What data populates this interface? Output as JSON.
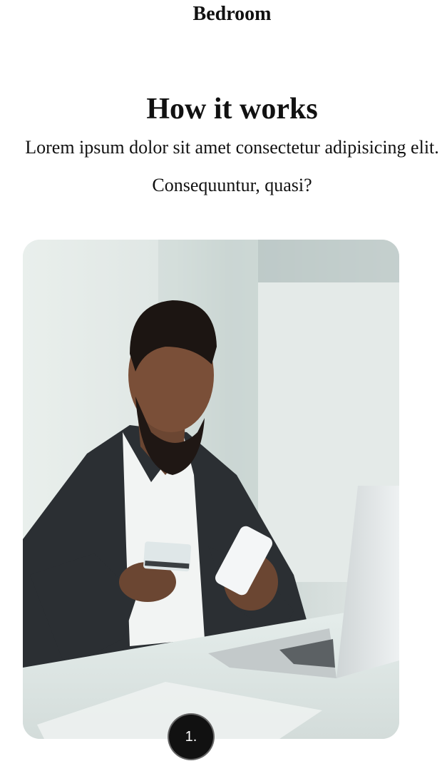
{
  "header": {
    "title": "Bedroom"
  },
  "how_it_works": {
    "heading": "How it works",
    "description": "Lorem ipsum dolor sit amet consectetur adipisicing elit. Consequuntur, quasi?",
    "steps": [
      {
        "number": "1.",
        "image": "man-paying-online-with-card-and-phone"
      }
    ]
  },
  "colors": {
    "badge_background": "#111111",
    "badge_text": "#ffffff",
    "text": "#111111",
    "page_background": "#ffffff"
  }
}
